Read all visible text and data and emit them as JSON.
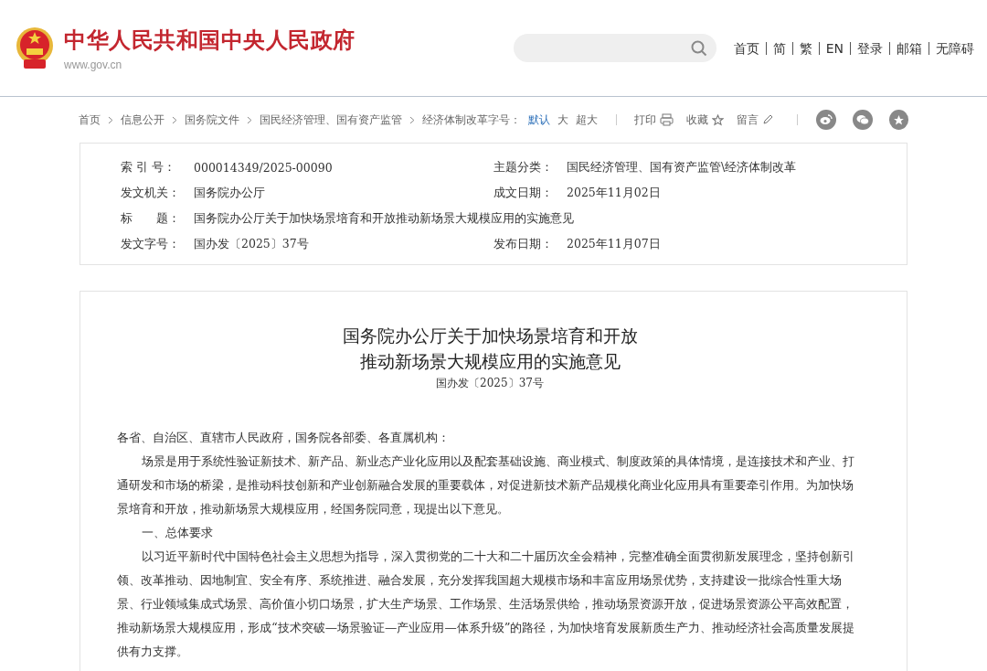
{
  "header": {
    "site_title": "中华人民共和国中央人民政府",
    "site_url": "www.gov.cn",
    "nav": [
      "首页",
      "简",
      "繁",
      "EN",
      "登录",
      "邮箱",
      "无障碍"
    ]
  },
  "breadcrumb": [
    "首页",
    "信息公开",
    "国务院文件",
    "国民经济管理、国有资产监管",
    "经济体制改革"
  ],
  "toolbar": {
    "font_label": "字号：",
    "font_sizes": [
      {
        "label": "默认",
        "selected": true
      },
      {
        "label": "大",
        "selected": false
      },
      {
        "label": "超大",
        "selected": false
      }
    ],
    "actions": [
      {
        "label": "打印",
        "kind": "print"
      },
      {
        "label": "收藏",
        "kind": "star"
      },
      {
        "label": "留言",
        "kind": "pencil"
      }
    ],
    "share": [
      {
        "kind": "weibo"
      },
      {
        "kind": "wechat"
      },
      {
        "kind": "favorite"
      }
    ]
  },
  "meta": [
    {
      "label": "索 引 号：",
      "value": "000014349/2025-00090"
    },
    {
      "label": "主题分类：",
      "value": "国民经济管理、国有资产监管\\经济体制改革"
    },
    {
      "label": "发文机关：",
      "value": "国务院办公厅"
    },
    {
      "label": "成文日期：",
      "value": "2025年11月02日"
    },
    {
      "label": "标　　题：",
      "value": "国务院办公厅关于加快场景培育和开放推动新场景大规模应用的实施意见",
      "wide": true
    },
    {
      "label": "发文字号：",
      "value": "国办发〔2025〕37号"
    },
    {
      "label": "发布日期：",
      "value": "2025年11月07日"
    }
  ],
  "article": {
    "title_lines": [
      "国务院办公厅关于加快场景培育和开放",
      "推动新场景大规模应用的实施意见"
    ],
    "doc_number": "国办发〔2025〕37号",
    "paragraphs": [
      {
        "kind": "salutation",
        "text": "各省、自治区、直辖市人民政府，国务院各部委、各直属机构："
      },
      {
        "kind": "body",
        "text": "场景是用于系统性验证新技术、新产品、新业态产业化应用以及配套基础设施、商业模式、制度政策的具体情境，是连接技术和产业、打通研发和市场的桥梁，是推动科技创新和产业创新融合发展的重要载体，对促进新技术新产品规模化商业化应用具有重要牵引作用。为加快场景培育和开放，推动新场景大规模应用，经国务院同意，现提出以下意见。"
      },
      {
        "kind": "heading",
        "text": "一、总体要求"
      },
      {
        "kind": "body",
        "text": "以习近平新时代中国特色社会主义思想为指导，深入贯彻党的二十大和二十届历次全会精神，完整准确全面贯彻新发展理念，坚持创新引领、改革推动、因地制宜、安全有序、系统推进、融合发展，充分发挥我国超大规模市场和丰富应用场景优势，支持建设一批综合性重大场景、行业领域集成式场景、高价值小切口场景，扩大生产场景、工作场景、生活场景供给，推动场景资源开放，促进场景资源公平高效配置，推动新场景大规模应用，形成“技术突破—场景验证—产业应用—体系升级”的路径，为加快培育发展新质生产力、推动经济社会高质量发展提供有力支撑。"
      }
    ]
  }
}
